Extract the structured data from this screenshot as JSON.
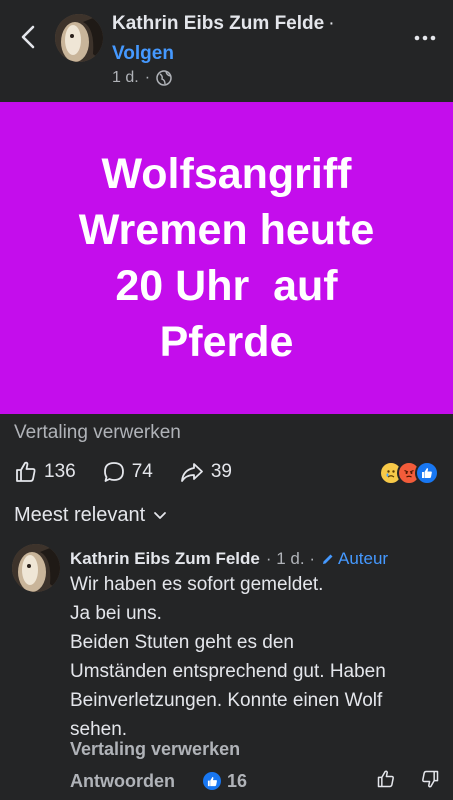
{
  "header": {
    "author": "Kathrin Eibs Zum Felde",
    "separator": "·",
    "follow_label": "Volgen",
    "time": "1 d.",
    "time_separator": "·"
  },
  "post": {
    "image_text": [
      "Wolfsangriff",
      "Wremen heute",
      "20 Uhr  auf",
      "Pferde"
    ],
    "image_background": "#c40dec",
    "translate_label": "Vertaling verwerken"
  },
  "stats": {
    "likes": "136",
    "comments": "74",
    "shares": "39",
    "reactions": [
      "sad",
      "angry",
      "like"
    ]
  },
  "sort": {
    "label": "Meest relevant"
  },
  "comment": {
    "author": "Kathrin Eibs Zum Felde",
    "time": "· 1 d. ·",
    "badge": "Auteur",
    "lines": [
      "Wir haben es sofort gemeldet.",
      "Ja bei uns.",
      "Beiden Stuten geht es den",
      "Umständen entsprechend gut. Haben",
      "Beinverletzungen. Konnte einen Wolf",
      "sehen."
    ],
    "translate_label": "Vertaling verwerken",
    "reply_label": "Antwoorden",
    "like_count": "16"
  },
  "colors": {
    "background": "#242526",
    "accent": "#4599ff",
    "like_blue": "#1877f2"
  }
}
